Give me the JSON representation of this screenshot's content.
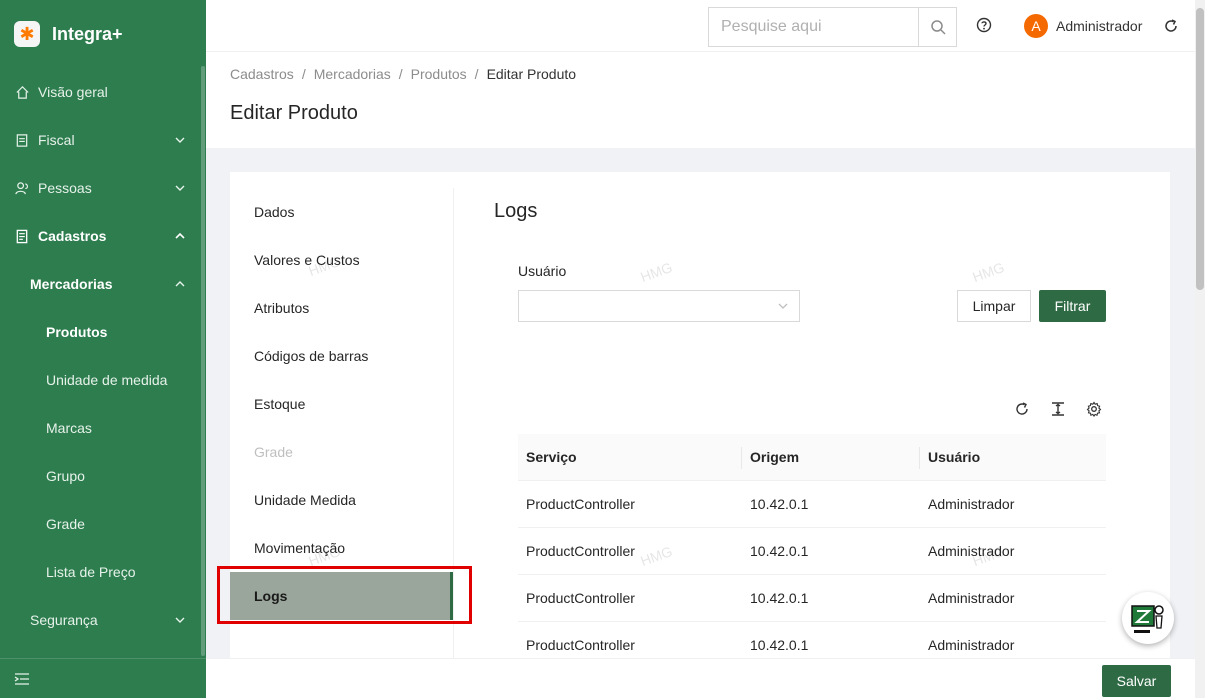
{
  "app": {
    "name": "Integra+"
  },
  "sidebar": {
    "items": [
      {
        "label": "Visão geral"
      },
      {
        "label": "Fiscal"
      },
      {
        "label": "Pessoas"
      },
      {
        "label": "Cadastros"
      },
      {
        "label": "Mercadorias"
      },
      {
        "label": "Produtos"
      },
      {
        "label": "Unidade de medida"
      },
      {
        "label": "Marcas"
      },
      {
        "label": "Grupo"
      },
      {
        "label": "Grade"
      },
      {
        "label": "Lista de Preço"
      },
      {
        "label": "Segurança"
      }
    ]
  },
  "header": {
    "search_placeholder": "Pesquise aqui",
    "avatar_letter": "A",
    "username": "Administrador"
  },
  "breadcrumb": [
    "Cadastros",
    "Mercadorias",
    "Produtos",
    "Editar Produto"
  ],
  "page_title": "Editar Produto",
  "tabs": [
    {
      "label": "Dados"
    },
    {
      "label": "Valores e Custos"
    },
    {
      "label": "Atributos"
    },
    {
      "label": "Códigos de barras"
    },
    {
      "label": "Estoque"
    },
    {
      "label": "Grade"
    },
    {
      "label": "Unidade Medida"
    },
    {
      "label": "Movimentação"
    },
    {
      "label": "Logs"
    }
  ],
  "logs": {
    "title": "Logs",
    "filter_label": "Usuário",
    "clear_button": "Limpar",
    "filter_button": "Filtrar",
    "columns": [
      "Serviço",
      "Origem",
      "Usuário"
    ],
    "rows": [
      [
        "ProductController",
        "10.42.0.1",
        "Administrador"
      ],
      [
        "ProductController",
        "10.42.0.1",
        "Administrador"
      ],
      [
        "ProductController",
        "10.42.0.1",
        "Administrador"
      ],
      [
        "ProductController",
        "10.42.0.1",
        "Administrador"
      ]
    ]
  },
  "watermark": "HMG",
  "footer": {
    "save_button": "Salvar"
  },
  "colors": {
    "sidebar": "#2e7d4f",
    "primary": "#2e6b45",
    "highlight": "#e00000",
    "avatar": "#f56a00"
  }
}
